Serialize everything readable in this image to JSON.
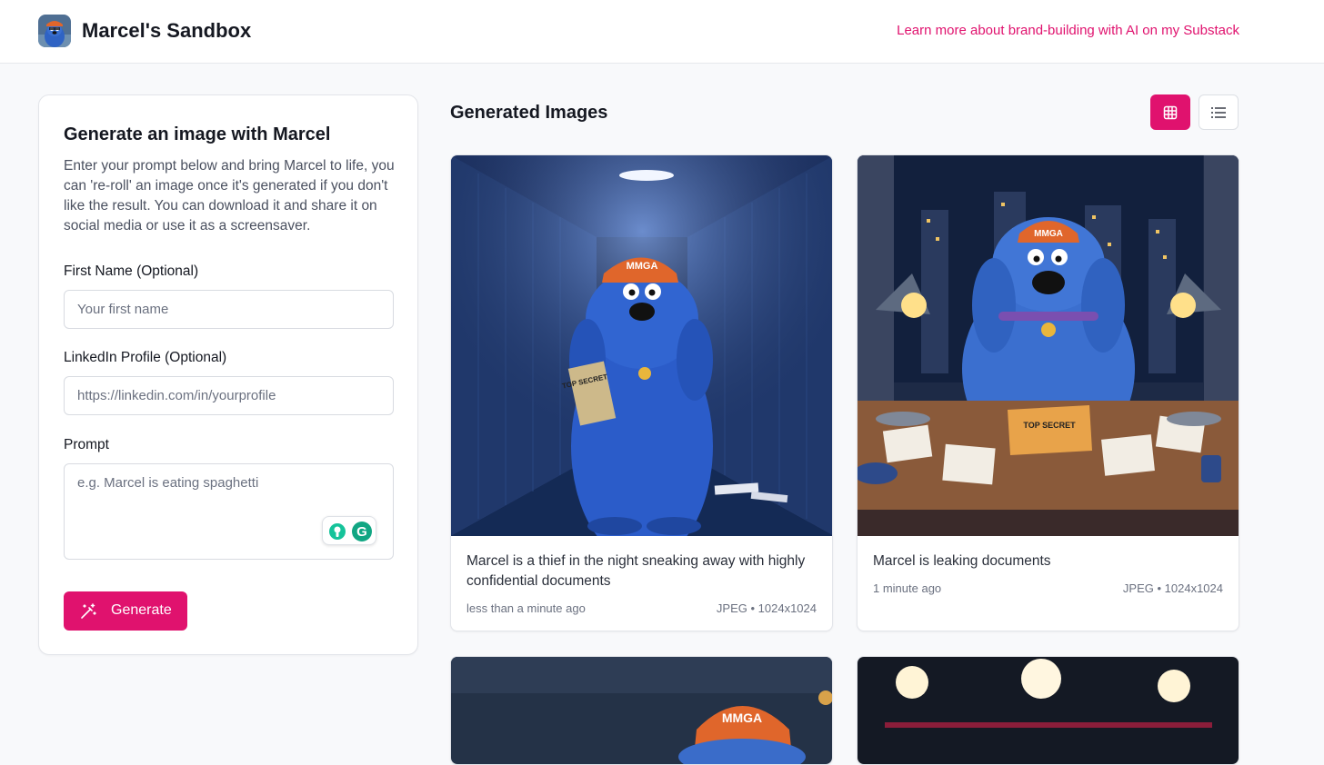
{
  "header": {
    "title": "Marcel's Sandbox",
    "substack_link": "Learn more about brand-building with AI on my Substack",
    "accent": "#e0126e"
  },
  "form": {
    "title": "Generate an image with Marcel",
    "description": "Enter your prompt below and bring Marcel to life, you can 're-roll' an image once it's generated if you don't like the result. You can download it and share it on social media or use it as a screensaver.",
    "first_name_label": "First Name (Optional)",
    "first_name_placeholder": "Your first name",
    "first_name_value": "",
    "linkedin_label": "LinkedIn Profile (Optional)",
    "linkedin_placeholder": "https://linkedin.com/in/yourprofile",
    "linkedin_value": "",
    "prompt_label": "Prompt",
    "prompt_placeholder": "e.g. Marcel is eating spaghetti",
    "prompt_value": "",
    "generate_label": "Generate"
  },
  "gallery": {
    "title": "Generated Images",
    "view_mode": "grid",
    "images": [
      {
        "caption": "Marcel is a thief in the night sneaking away with highly confidential documents",
        "time": "less than a minute ago",
        "spec": "JPEG • 1024x1024",
        "cap_text": "MMGA",
        "folder_text": "TOP SECRET"
      },
      {
        "caption": "Marcel is leaking documents",
        "time": "1 minute ago",
        "spec": "JPEG • 1024x1024",
        "cap_text": "MMGA",
        "folder_text": "TOP SECRET"
      },
      {
        "cap_text": "MMGA"
      }
    ]
  }
}
